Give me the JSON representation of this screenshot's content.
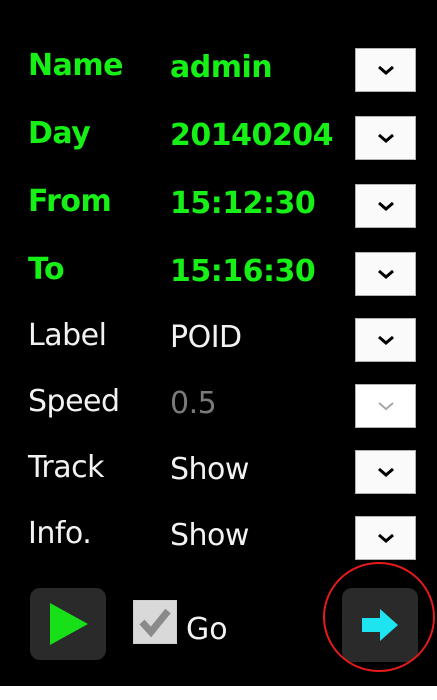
{
  "rows": [
    {
      "label": "Name",
      "value": "admin",
      "style": "green"
    },
    {
      "label": "Day",
      "value": "20140204",
      "style": "green"
    },
    {
      "label": "From",
      "value": "15:12:30",
      "style": "green"
    },
    {
      "label": "To",
      "value": "15:16:30",
      "style": "green"
    },
    {
      "label": "Label",
      "value": "POID",
      "style": "white"
    },
    {
      "label": "Speed",
      "value": "0.5",
      "style": "disabled"
    },
    {
      "label": "Track",
      "value": "Show",
      "style": "white"
    },
    {
      "label": "Info.",
      "value": "Show",
      "style": "white"
    }
  ],
  "controls": {
    "go_label": "Go",
    "go_checked": true,
    "play_icon": "play-icon",
    "arrow_icon": "arrow-right-icon"
  },
  "colors": {
    "background": "#000000",
    "green_text": "#16f016",
    "white_text": "#f2f2f2",
    "disabled_text": "#7a7a7a",
    "play_green": "#18e018",
    "arrow_cyan": "#1ee4f0",
    "highlight_ring": "#e51a1a"
  }
}
